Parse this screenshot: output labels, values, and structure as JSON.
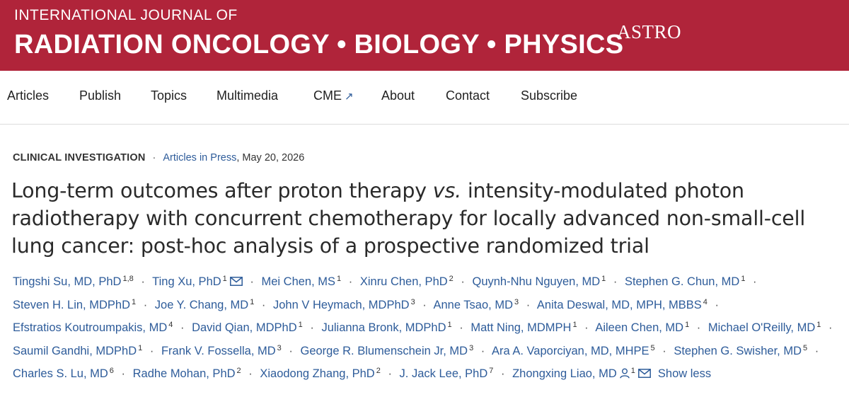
{
  "journal": {
    "line1": "INTERNATIONAL JOURNAL OF",
    "line2": "RADIATION ONCOLOGY • BIOLOGY • PHYSICS",
    "society_logo_text": "ASTRO",
    "brand_color": "#b0243a"
  },
  "nav": {
    "items": [
      "Articles",
      "Publish",
      "Topics",
      "Multimedia",
      "CME",
      "About",
      "Contact",
      "Subscribe"
    ],
    "cme_icon": "external-link-arrow"
  },
  "article_meta": {
    "section": "CLINICAL INVESTIGATION",
    "dot": "·",
    "status_link": "Articles in Press",
    "date": ", May 20, 2026"
  },
  "article": {
    "title_part1": "Long-term outcomes after proton therapy ",
    "title_vs": "vs.",
    "title_part2": " intensity-modulated photon radiotherapy with concurrent chemotherapy for locally advanced non-small-cell lung cancer: post-hoc analysis of a prospective randomized trial"
  },
  "authors": [
    {
      "name": "Tingshi Su, MD, PhD",
      "aff": "1,8"
    },
    {
      "name": "Ting Xu, PhD",
      "aff": "1",
      "mail": true
    },
    {
      "name": "Mei Chen, MS",
      "aff": "1"
    },
    {
      "name": "Xinru Chen, PhD",
      "aff": "2"
    },
    {
      "name": "Quynh-Nhu Nguyen, MD",
      "aff": "1"
    },
    {
      "name": "Stephen G. Chun, MD",
      "aff": "1"
    },
    {
      "name": "Steven H. Lin, MDPhD",
      "aff": "1"
    },
    {
      "name": "Joe Y. Chang, MD",
      "aff": "1"
    },
    {
      "name": "John V Heymach, MDPhD",
      "aff": "3"
    },
    {
      "name": "Anne Tsao, MD",
      "aff": "3"
    },
    {
      "name": "Anita Deswal, MD, MPH, MBBS",
      "aff": "4"
    },
    {
      "name": "Efstratios Koutroumpakis, MD",
      "aff": "4"
    },
    {
      "name": "David Qian, MDPhD",
      "aff": "1"
    },
    {
      "name": "Julianna Bronk, MDPhD",
      "aff": "1"
    },
    {
      "name": "Matt Ning, MDMPH",
      "aff": "1"
    },
    {
      "name": "Aileen Chen, MD",
      "aff": "1"
    },
    {
      "name": "Michael O'Reilly, MD",
      "aff": "1"
    },
    {
      "name": "Saumil Gandhi, MDPhD",
      "aff": "1"
    },
    {
      "name": "Frank V. Fossella, MD",
      "aff": "3"
    },
    {
      "name": "George R. Blumenschein Jr, MD",
      "aff": "3"
    },
    {
      "name": "Ara A. Vaporciyan, MD, MHPE",
      "aff": "5"
    },
    {
      "name": "Stephen G. Swisher, MD",
      "aff": "5"
    },
    {
      "name": "Charles S. Lu, MD",
      "aff": "6"
    },
    {
      "name": "Radhe Mohan, PhD",
      "aff": "2"
    },
    {
      "name": "Xiaodong Zhang, PhD",
      "aff": "2"
    },
    {
      "name": "J. Jack Lee, PhD",
      "aff": "7"
    },
    {
      "name": "Zhongxing Liao, MD",
      "aff": "1",
      "person": true,
      "mail": true
    }
  ],
  "authors_toggle": "Show less",
  "separator": "·",
  "link_color": "#2e5c9a"
}
